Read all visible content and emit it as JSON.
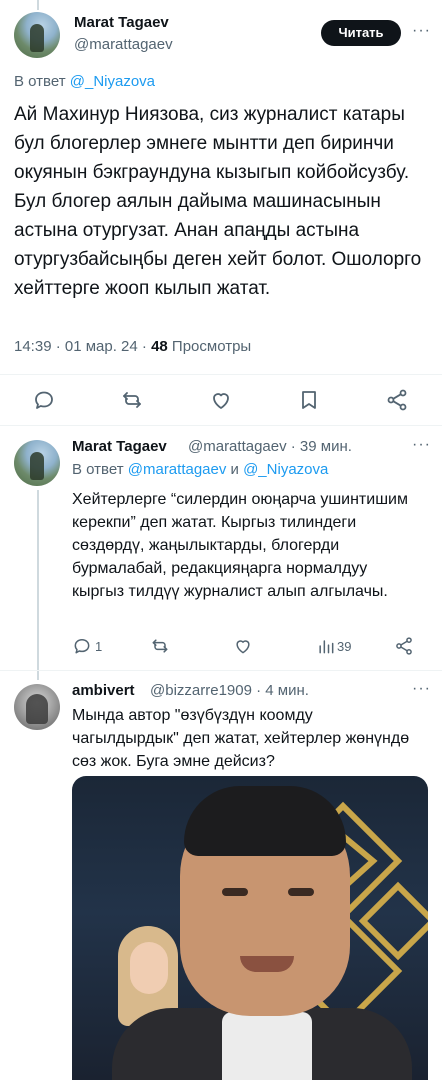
{
  "main_tweet": {
    "name": "Marat Tagaev",
    "handle": "@marattagaev",
    "read_button": "Читать",
    "more": "···",
    "reply_to_prefix": "В ответ",
    "reply_to_mention": "@_Niyazova",
    "text": "Ай Махинур Ниязова, сиз журналист катары бул блогерлер эмнеге мынтти деп биринчи окуянын бэкграундуна кызыгып койбойсузбу. Бул блогер аялын дайыма машинасынын астына отургузат. Анан апаңды астына отургузбайсыңбы деген хейт болот. Ошолорго хейттерге жооп кылып жатат.",
    "time": "14:39 · 01 мар. 24 · ",
    "views_count": "48",
    "views_label": " Просмотры",
    "actions": [
      "reply-icon",
      "retweet-icon",
      "like-icon",
      "bookmark-icon",
      "share-icon"
    ]
  },
  "reply_tweet": {
    "name": "Marat Tagaev",
    "handle_time": "@marattagaev · 39 мин.",
    "more": "···",
    "reply_to_prefix": "В ответ ",
    "reply_to_mention_1": "@marattagaev",
    "reply_to_and": " и ",
    "reply_to_mention_2": "@_Niyazova",
    "text": "Хейтерлерге “силердин оюңарча ушинтишим керекпи” деп жатат. Кыргыз тилиндеги сөздөрдү, жаңылыктарды, блогерди бурмалабай, редакцияңарга нормалдуу кыргыз тилдүү журналист алып алгылачы.",
    "reply_count": "1",
    "views_count": "39"
  },
  "third_tweet": {
    "name": "ambivert",
    "handle_time": "@bizzarre1909 · 4 мин.",
    "more": "···",
    "text": "Мында автор \"өзүбүздүн коомду чагылдырдык\" деп жатат, хейтерлер жөнүндө сөз жок. Буга эмне дейсиз?"
  },
  "colors": {
    "text": "#0f1419",
    "secondary": "#536471",
    "link": "#1d9bf0",
    "divider": "#eff3f4",
    "button": "#0f1419"
  }
}
